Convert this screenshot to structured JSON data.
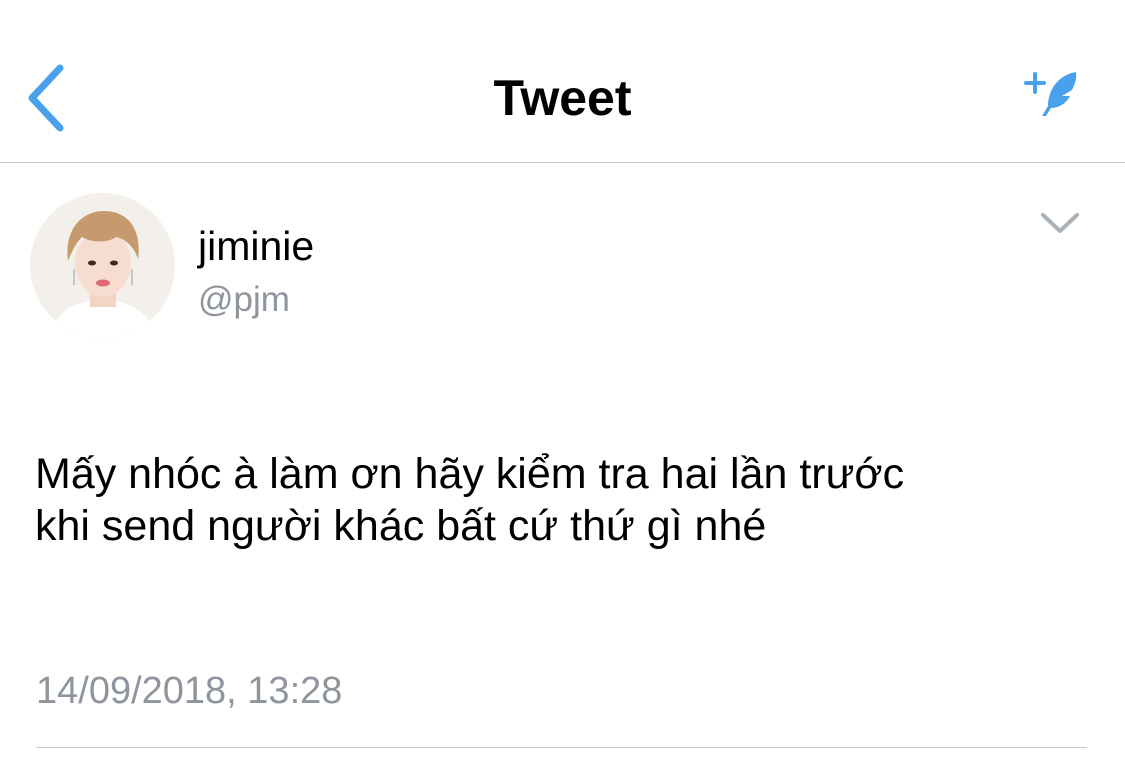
{
  "nav": {
    "title": "Tweet",
    "back_icon": "chevron-left-icon",
    "compose_icon": "compose-tweet-icon",
    "accent_color": "#4aa1eb"
  },
  "author": {
    "display_name": "jiminie",
    "handle": "@pjm",
    "avatar_icon": "avatar"
  },
  "tweet": {
    "text_line_1": "Mấy nhóc à làm ơn hãy kiểm tra hai lần trước",
    "text_line_2": "khi send người khác bất cứ thứ gì nhé",
    "timestamp": "14/09/2018, 13:28",
    "menu_icon": "chevron-down-icon"
  },
  "colors": {
    "text_primary": "#000000",
    "text_secondary": "#8e959c",
    "divider": "#c8c8cc",
    "background": "#ffffff"
  }
}
